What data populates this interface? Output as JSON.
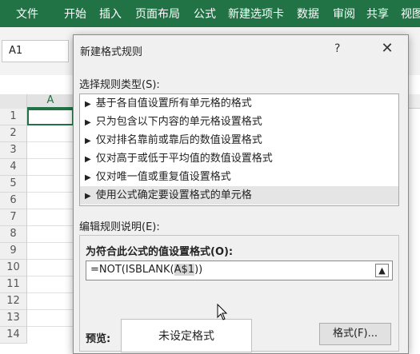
{
  "ribbon": {
    "tabs": [
      "文件",
      "开始",
      "插入",
      "页面布局",
      "公式",
      "新建选项卡",
      "数据",
      "审阅",
      "共享",
      "视图"
    ],
    "color": "#217346"
  },
  "namebox": {
    "value": "A1"
  },
  "grid": {
    "column_a": "A",
    "rows": [
      "1",
      "2",
      "3",
      "4",
      "5",
      "6",
      "7",
      "8",
      "9",
      "10",
      "11",
      "12",
      "13",
      "14"
    ]
  },
  "dialog": {
    "title": "新建格式规则",
    "help": "?",
    "close": "✕",
    "rule_type_label": "选择规则类型(S):",
    "rule_types": [
      "基于各自值设置所有单元格的格式",
      "只为包含以下内容的单元格设置格式",
      "仅对排名靠前或靠后的数值设置格式",
      "仅对高于或低于平均值的数值设置格式",
      "仅对唯一值或重复值设置格式",
      "使用公式确定要设置格式的单元格"
    ],
    "selected_index": 5,
    "edit_label": "编辑规则说明(E):",
    "formula_label": "为符合此公式的值设置格式(O):",
    "formula_prefix": "=NOT(ISBLANK(",
    "formula_ref": "A$1",
    "formula_suffix": "))",
    "preview_label": "预览:",
    "preview_text": "未设定格式",
    "format_button": "格式(F)..."
  }
}
